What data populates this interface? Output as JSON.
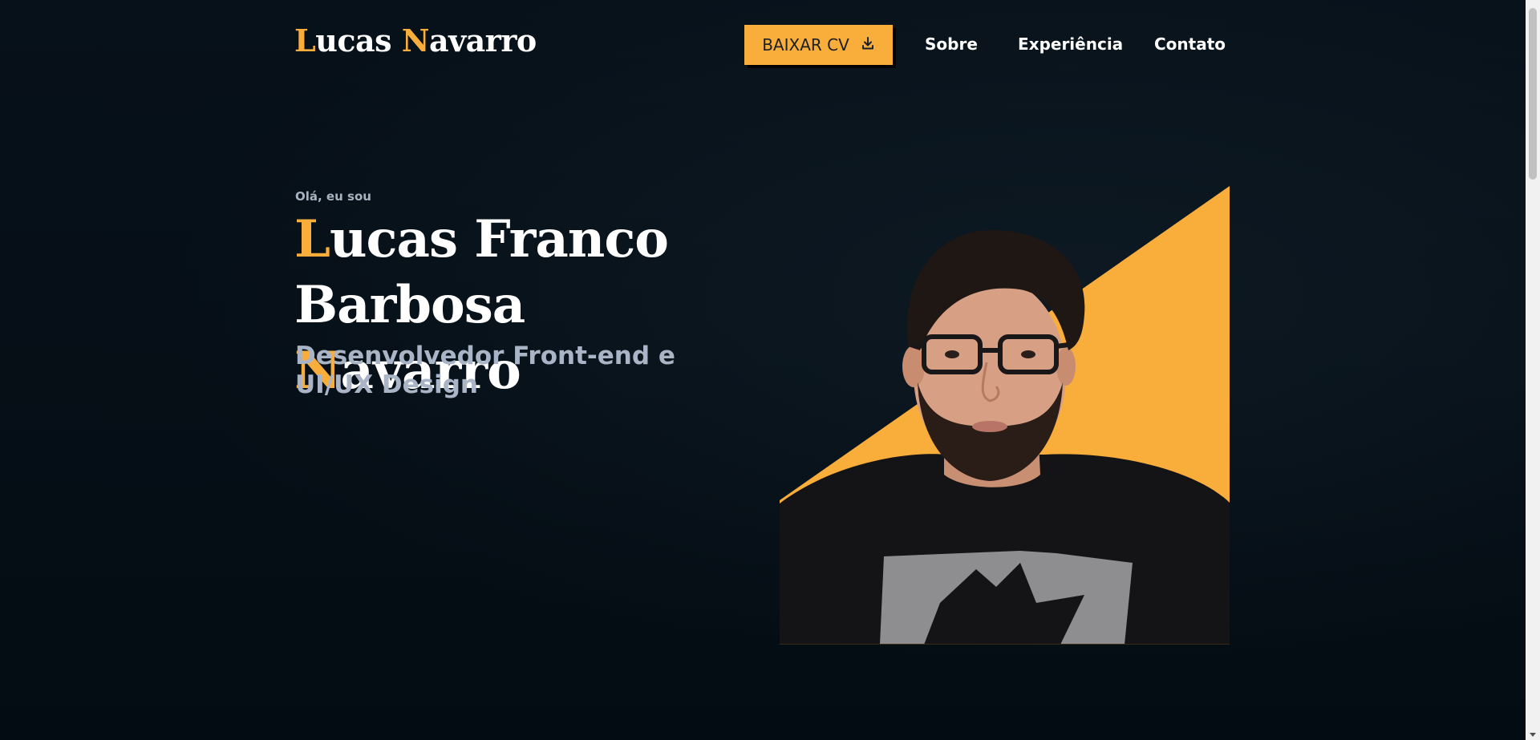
{
  "header": {
    "logo": {
      "first_initial": "L",
      "first_rest": "ucas ",
      "last_initial": "N",
      "last_rest": "avarro"
    },
    "cv_button_label": "BAIXAR CV",
    "cv_button_icon": "download-icon",
    "nav": [
      "Sobre",
      "Experiência",
      "Contato"
    ]
  },
  "hero": {
    "greeting": "Olá, eu sou",
    "name_line1": {
      "initial": "L",
      "rest": "ucas Franco"
    },
    "name_line2": {
      "prefix": "Barbosa ",
      "initial": "N",
      "rest": "avarro"
    },
    "role": "Desenvolvedor Front-end e UI/UX Design",
    "photo": "portrait-photo"
  },
  "colors": {
    "accent": "#f9ae3c",
    "background": "#06101a",
    "text": "#ffffff",
    "muted": "#a9b5c6"
  }
}
